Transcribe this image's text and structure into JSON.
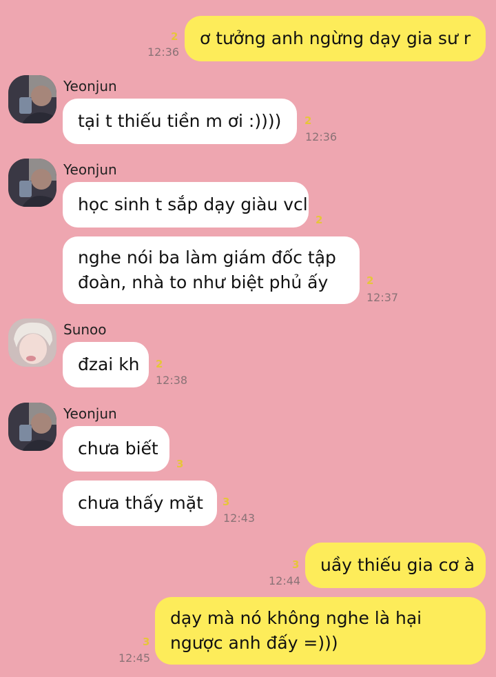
{
  "messages": [
    {
      "id": "m1",
      "text": "ơ tưởng anh ngừng dạy gia sư r",
      "unread": "2",
      "time": "12:36"
    },
    {
      "id": "m2",
      "sender": "Yeonjun",
      "text": "tại t thiếu tiền m ơi :))))",
      "unread": "2",
      "time": "12:36"
    },
    {
      "id": "m3",
      "sender": "Yeonjun",
      "text": "học sinh t sắp dạy giàu vcl",
      "unread": "2"
    },
    {
      "id": "m4",
      "text": "nghe nói ba làm giám đốc tập đoàn, nhà to như biệt phủ ấy",
      "unread": "2",
      "time": "12:37"
    },
    {
      "id": "m5",
      "sender": "Sunoo",
      "text": "đzai kh",
      "unread": "2",
      "time": "12:38"
    },
    {
      "id": "m6",
      "sender": "Yeonjun",
      "text": "chưa biết",
      "unread": "3"
    },
    {
      "id": "m7",
      "text": "chưa thấy mặt",
      "unread": "3",
      "time": "12:43"
    },
    {
      "id": "m8",
      "text": "uầy thiếu gia cơ à",
      "unread": "3",
      "time": "12:44"
    },
    {
      "id": "m9",
      "text": "dạy mà nó không nghe là hại ngược anh đấy =)))",
      "unread": "3",
      "time": "12:45"
    }
  ],
  "colors": {
    "background": "#eea6b0",
    "outgoing_bubble": "#fdec5a",
    "incoming_bubble": "#ffffff",
    "unread_count": "#e6c53a"
  },
  "icons": {
    "yeonjun_avatar": "avatar-photo",
    "sunoo_avatar": "avatar-photo"
  }
}
